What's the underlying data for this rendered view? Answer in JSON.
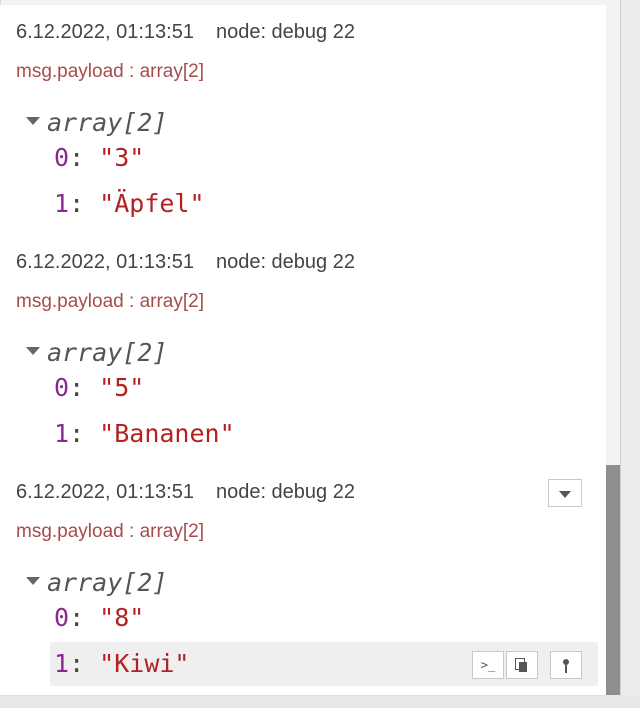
{
  "messages": [
    {
      "timestamp": "6.12.2022, 01:13:51",
      "node": "node: debug 22",
      "topic": "msg.payload : array[2]",
      "tree_label": "array[2]",
      "items": [
        {
          "index": "0",
          "value": "\"3\""
        },
        {
          "index": "1",
          "value": "\"Äpfel\""
        }
      ]
    },
    {
      "timestamp": "6.12.2022, 01:13:51",
      "node": "node: debug 22",
      "topic": "msg.payload : array[2]",
      "tree_label": "array[2]",
      "items": [
        {
          "index": "0",
          "value": "\"5\""
        },
        {
          "index": "1",
          "value": "\"Bananen\""
        }
      ]
    },
    {
      "timestamp": "6.12.2022, 01:13:51",
      "node": "node: debug 22",
      "topic": "msg.payload : array[2]",
      "tree_label": "array[2]",
      "items": [
        {
          "index": "0",
          "value": "\"8\""
        },
        {
          "index": "1",
          "value": "\"Kiwi\""
        }
      ]
    }
  ],
  "hover_tools": [
    {
      "icon": "terminal-icon",
      "label": ">_"
    },
    {
      "icon": "copy-icon"
    },
    {
      "icon": "pin-icon"
    }
  ],
  "colors": {
    "topic": "#a64c4c",
    "index": "#8a2a8f",
    "string_value": "#b22222"
  }
}
